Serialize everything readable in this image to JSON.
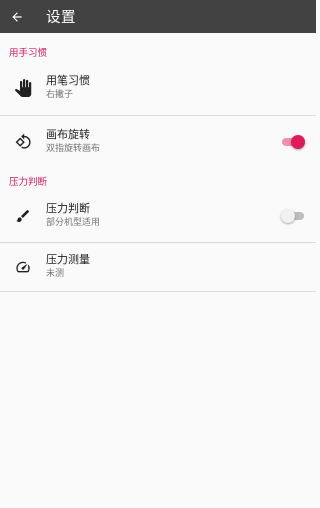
{
  "appbar": {
    "title": "设置",
    "back_icon": "arrow-back-icon",
    "background": "#424242"
  },
  "accent_color": "#d81b60",
  "sections": [
    {
      "header": "用手习惯",
      "items": [
        {
          "title": "用笔习惯",
          "summary": "右撇子",
          "icon": "hand-icon"
        },
        {
          "title": "画布旋转",
          "summary": "双指旋转画布",
          "icon": "rotate-icon",
          "switch": true
        }
      ]
    },
    {
      "header": "压力判断",
      "items": [
        {
          "title": "压力判断",
          "summary": "部分机型适用",
          "icon": "brush-icon",
          "switch": false
        },
        {
          "title": "压力测量",
          "summary": "未测",
          "icon": "speedometer-icon"
        }
      ]
    }
  ]
}
